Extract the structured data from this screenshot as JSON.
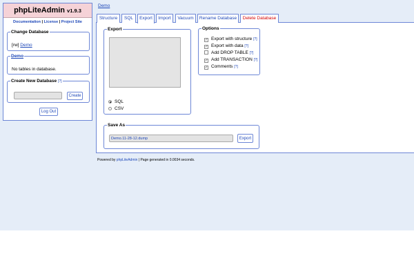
{
  "app": {
    "name": "phpLiteAdmin",
    "version": "v1.9.3",
    "links": {
      "documentation": "Documentation",
      "sep1": " | ",
      "license": "License",
      "sep2": " | ",
      "project": "Project Site"
    }
  },
  "sidebar": {
    "change_db": {
      "legend": "Change Database",
      "prefix": "[rw]",
      "db_link": "Demo"
    },
    "current_db": {
      "legend": "Demo",
      "message": "No tables in database."
    },
    "create_db": {
      "legend": "Create New Database",
      "help": "[?]",
      "input_value": "",
      "button": "Create"
    },
    "logout": "Log Out"
  },
  "breadcrumb": "Demo",
  "tabs": [
    {
      "label": "Structure"
    },
    {
      "label": "SQL"
    },
    {
      "label": "Export",
      "active": true
    },
    {
      "label": "Import"
    },
    {
      "label": "Vacuum"
    },
    {
      "label": "Rename Database"
    },
    {
      "label": "Delete Database",
      "danger": true
    }
  ],
  "export": {
    "legend": "Export",
    "tables_selected": "",
    "formats": [
      {
        "label": "SQL",
        "selected": true
      },
      {
        "label": "CSV",
        "selected": false
      }
    ]
  },
  "options": {
    "legend": "Options",
    "help": "[?]",
    "items": [
      {
        "label": "Export with structure",
        "checked": true,
        "help": "[?]"
      },
      {
        "label": "Export with data",
        "checked": true,
        "help": "[?]"
      },
      {
        "label": "Add DROP TABLE",
        "checked": false,
        "help": "[?]"
      },
      {
        "label": "Add TRANSACTION",
        "checked": true,
        "help": "[?]"
      },
      {
        "label": "Comments",
        "checked": true,
        "help": "[?]"
      }
    ]
  },
  "save_as": {
    "legend": "Save As",
    "filename": "Demo.11-28-12.dump",
    "button": "Export"
  },
  "footer": {
    "prefix": "Powered by ",
    "link": "phpLiteAdmin",
    "suffix": " | Page generated in 0.0034 seconds."
  },
  "colors": {
    "border": "#6c86d6",
    "link": "#1d47b8",
    "danger": "#d40000",
    "brand_bg": "#f5d2d7",
    "page_bg": "#e5edf8"
  }
}
